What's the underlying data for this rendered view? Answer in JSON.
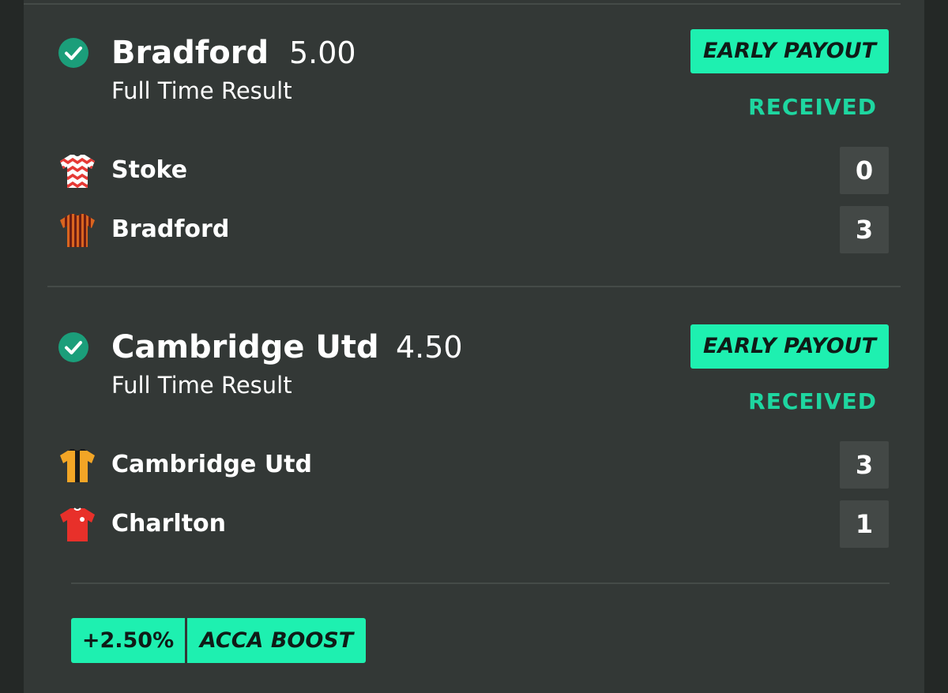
{
  "selections": [
    {
      "name": "Bradford",
      "odds": "5.00",
      "market": "Full Time Result",
      "payout_badge": "EARLY PAYOUT",
      "payout_status": "RECEIVED",
      "status_icon": "check-circle-icon",
      "teams": [
        {
          "name": "Stoke",
          "score": "0",
          "kit": "stoke-shirt-icon"
        },
        {
          "name": "Bradford",
          "score": "3",
          "kit": "bradford-shirt-icon"
        }
      ]
    },
    {
      "name": "Cambridge Utd",
      "odds": "4.50",
      "market": "Full Time Result",
      "payout_badge": "EARLY PAYOUT",
      "payout_status": "RECEIVED",
      "status_icon": "check-circle-icon",
      "teams": [
        {
          "name": "Cambridge Utd",
          "score": "3",
          "kit": "cambridge-utd-shirt-icon"
        },
        {
          "name": "Charlton",
          "score": "1",
          "kit": "charlton-shirt-icon"
        }
      ]
    }
  ],
  "acca_boost": {
    "percent": "+2.50%",
    "label": "ACCA BOOST"
  },
  "colors": {
    "accent": "#1ef0b0",
    "received": "#1ed6a0",
    "check": "#1b9e7a",
    "card": "#333836",
    "background": "#242826"
  }
}
